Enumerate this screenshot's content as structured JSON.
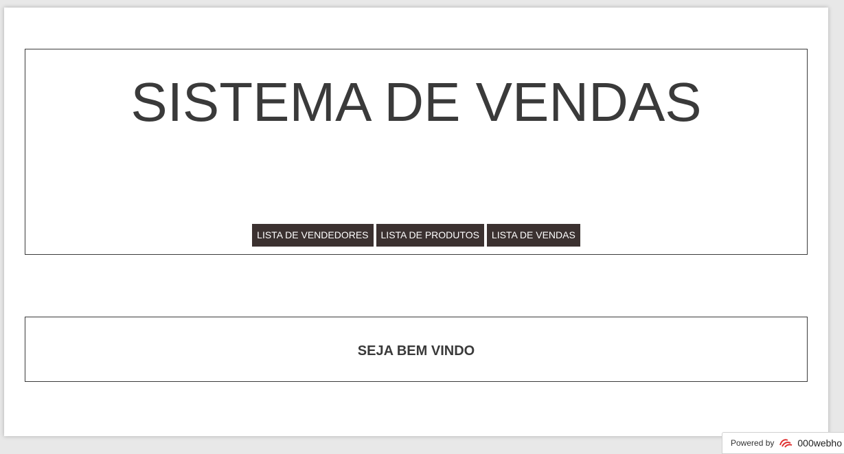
{
  "header": {
    "title": "SISTEMA DE VENDAS"
  },
  "nav": {
    "items": [
      {
        "label": "LISTA DE VENDEDORES"
      },
      {
        "label": "LISTA DE PRODUTOS"
      },
      {
        "label": "LISTA DE VENDAS"
      }
    ]
  },
  "main": {
    "welcome": "SEJA BEM VINDO"
  },
  "footer_badge": {
    "prefix": "Powered by",
    "brand": "000webho",
    "icon": "000webhost-logo-icon"
  },
  "colors": {
    "nav_button_bg": "#3b3130",
    "text": "#3a3a3a",
    "border": "#3a3a3a"
  }
}
